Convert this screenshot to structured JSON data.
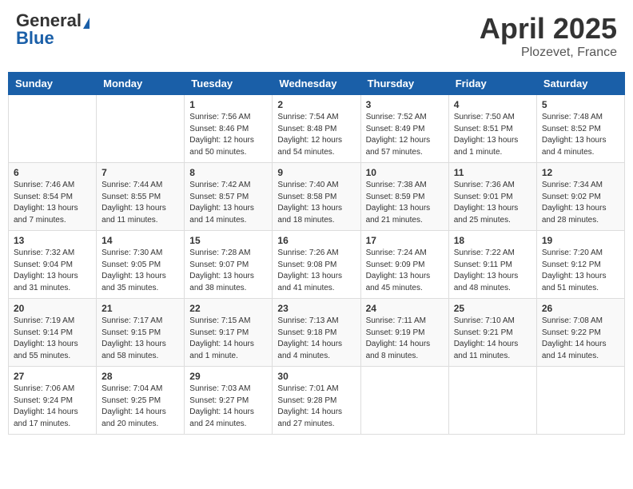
{
  "header": {
    "logo_general": "General",
    "logo_blue": "Blue",
    "title": "April 2025",
    "location": "Plozevet, France"
  },
  "days_of_week": [
    "Sunday",
    "Monday",
    "Tuesday",
    "Wednesday",
    "Thursday",
    "Friday",
    "Saturday"
  ],
  "weeks": [
    [
      {
        "day": null,
        "info": null
      },
      {
        "day": null,
        "info": null
      },
      {
        "day": "1",
        "info": "Sunrise: 7:56 AM\nSunset: 8:46 PM\nDaylight: 12 hours and 50 minutes."
      },
      {
        "day": "2",
        "info": "Sunrise: 7:54 AM\nSunset: 8:48 PM\nDaylight: 12 hours and 54 minutes."
      },
      {
        "day": "3",
        "info": "Sunrise: 7:52 AM\nSunset: 8:49 PM\nDaylight: 12 hours and 57 minutes."
      },
      {
        "day": "4",
        "info": "Sunrise: 7:50 AM\nSunset: 8:51 PM\nDaylight: 13 hours and 1 minute."
      },
      {
        "day": "5",
        "info": "Sunrise: 7:48 AM\nSunset: 8:52 PM\nDaylight: 13 hours and 4 minutes."
      }
    ],
    [
      {
        "day": "6",
        "info": "Sunrise: 7:46 AM\nSunset: 8:54 PM\nDaylight: 13 hours and 7 minutes."
      },
      {
        "day": "7",
        "info": "Sunrise: 7:44 AM\nSunset: 8:55 PM\nDaylight: 13 hours and 11 minutes."
      },
      {
        "day": "8",
        "info": "Sunrise: 7:42 AM\nSunset: 8:57 PM\nDaylight: 13 hours and 14 minutes."
      },
      {
        "day": "9",
        "info": "Sunrise: 7:40 AM\nSunset: 8:58 PM\nDaylight: 13 hours and 18 minutes."
      },
      {
        "day": "10",
        "info": "Sunrise: 7:38 AM\nSunset: 8:59 PM\nDaylight: 13 hours and 21 minutes."
      },
      {
        "day": "11",
        "info": "Sunrise: 7:36 AM\nSunset: 9:01 PM\nDaylight: 13 hours and 25 minutes."
      },
      {
        "day": "12",
        "info": "Sunrise: 7:34 AM\nSunset: 9:02 PM\nDaylight: 13 hours and 28 minutes."
      }
    ],
    [
      {
        "day": "13",
        "info": "Sunrise: 7:32 AM\nSunset: 9:04 PM\nDaylight: 13 hours and 31 minutes."
      },
      {
        "day": "14",
        "info": "Sunrise: 7:30 AM\nSunset: 9:05 PM\nDaylight: 13 hours and 35 minutes."
      },
      {
        "day": "15",
        "info": "Sunrise: 7:28 AM\nSunset: 9:07 PM\nDaylight: 13 hours and 38 minutes."
      },
      {
        "day": "16",
        "info": "Sunrise: 7:26 AM\nSunset: 9:08 PM\nDaylight: 13 hours and 41 minutes."
      },
      {
        "day": "17",
        "info": "Sunrise: 7:24 AM\nSunset: 9:09 PM\nDaylight: 13 hours and 45 minutes."
      },
      {
        "day": "18",
        "info": "Sunrise: 7:22 AM\nSunset: 9:11 PM\nDaylight: 13 hours and 48 minutes."
      },
      {
        "day": "19",
        "info": "Sunrise: 7:20 AM\nSunset: 9:12 PM\nDaylight: 13 hours and 51 minutes."
      }
    ],
    [
      {
        "day": "20",
        "info": "Sunrise: 7:19 AM\nSunset: 9:14 PM\nDaylight: 13 hours and 55 minutes."
      },
      {
        "day": "21",
        "info": "Sunrise: 7:17 AM\nSunset: 9:15 PM\nDaylight: 13 hours and 58 minutes."
      },
      {
        "day": "22",
        "info": "Sunrise: 7:15 AM\nSunset: 9:17 PM\nDaylight: 14 hours and 1 minute."
      },
      {
        "day": "23",
        "info": "Sunrise: 7:13 AM\nSunset: 9:18 PM\nDaylight: 14 hours and 4 minutes."
      },
      {
        "day": "24",
        "info": "Sunrise: 7:11 AM\nSunset: 9:19 PM\nDaylight: 14 hours and 8 minutes."
      },
      {
        "day": "25",
        "info": "Sunrise: 7:10 AM\nSunset: 9:21 PM\nDaylight: 14 hours and 11 minutes."
      },
      {
        "day": "26",
        "info": "Sunrise: 7:08 AM\nSunset: 9:22 PM\nDaylight: 14 hours and 14 minutes."
      }
    ],
    [
      {
        "day": "27",
        "info": "Sunrise: 7:06 AM\nSunset: 9:24 PM\nDaylight: 14 hours and 17 minutes."
      },
      {
        "day": "28",
        "info": "Sunrise: 7:04 AM\nSunset: 9:25 PM\nDaylight: 14 hours and 20 minutes."
      },
      {
        "day": "29",
        "info": "Sunrise: 7:03 AM\nSunset: 9:27 PM\nDaylight: 14 hours and 24 minutes."
      },
      {
        "day": "30",
        "info": "Sunrise: 7:01 AM\nSunset: 9:28 PM\nDaylight: 14 hours and 27 minutes."
      },
      {
        "day": null,
        "info": null
      },
      {
        "day": null,
        "info": null
      },
      {
        "day": null,
        "info": null
      }
    ]
  ]
}
